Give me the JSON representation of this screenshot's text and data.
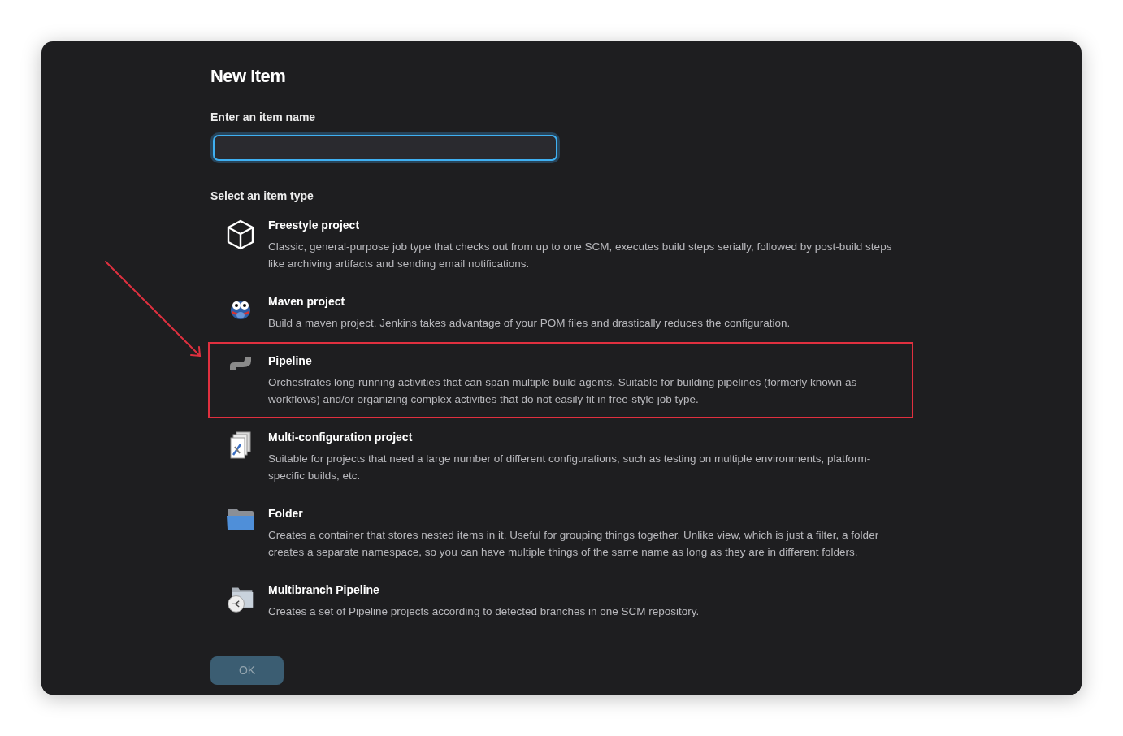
{
  "title": "New Item",
  "name_field": {
    "label": "Enter an item name"
  },
  "item_types": {
    "label": "Select an item type",
    "items": [
      {
        "kind": "freestyle",
        "name": "Freestyle project",
        "description": "Classic, general-purpose job type that checks out from up to one SCM, executes build steps serially, followed by post-build steps like archiving artifacts and sending email notifications.",
        "highlighted": false
      },
      {
        "kind": "maven",
        "name": "Maven project",
        "description": "Build a maven project. Jenkins takes advantage of your POM files and drastically reduces the configuration.",
        "highlighted": false
      },
      {
        "kind": "pipeline",
        "name": "Pipeline",
        "description": "Orchestrates long-running activities that can span multiple build agents. Suitable for building pipelines (formerly known as workflows) and/or organizing complex activities that do not easily fit in free-style job type.",
        "highlighted": true
      },
      {
        "kind": "multiconfig",
        "name": "Multi-configuration project",
        "description": "Suitable for projects that need a large number of different configurations, such as testing on multiple environments, platform-specific builds, etc.",
        "highlighted": false
      },
      {
        "kind": "folder",
        "name": "Folder",
        "description": "Creates a container that stores nested items in it. Useful for grouping things together. Unlike view, which is just a filter, a folder creates a separate namespace, so you can have multiple things of the same name as long as they are in different folders.",
        "highlighted": false
      },
      {
        "kind": "multibranch",
        "name": "Multibranch Pipeline",
        "description": "Creates a set of Pipeline projects according to detected branches in one SCM repository.",
        "highlighted": false
      }
    ]
  },
  "ok_button": {
    "label": "OK",
    "disabled": true
  }
}
